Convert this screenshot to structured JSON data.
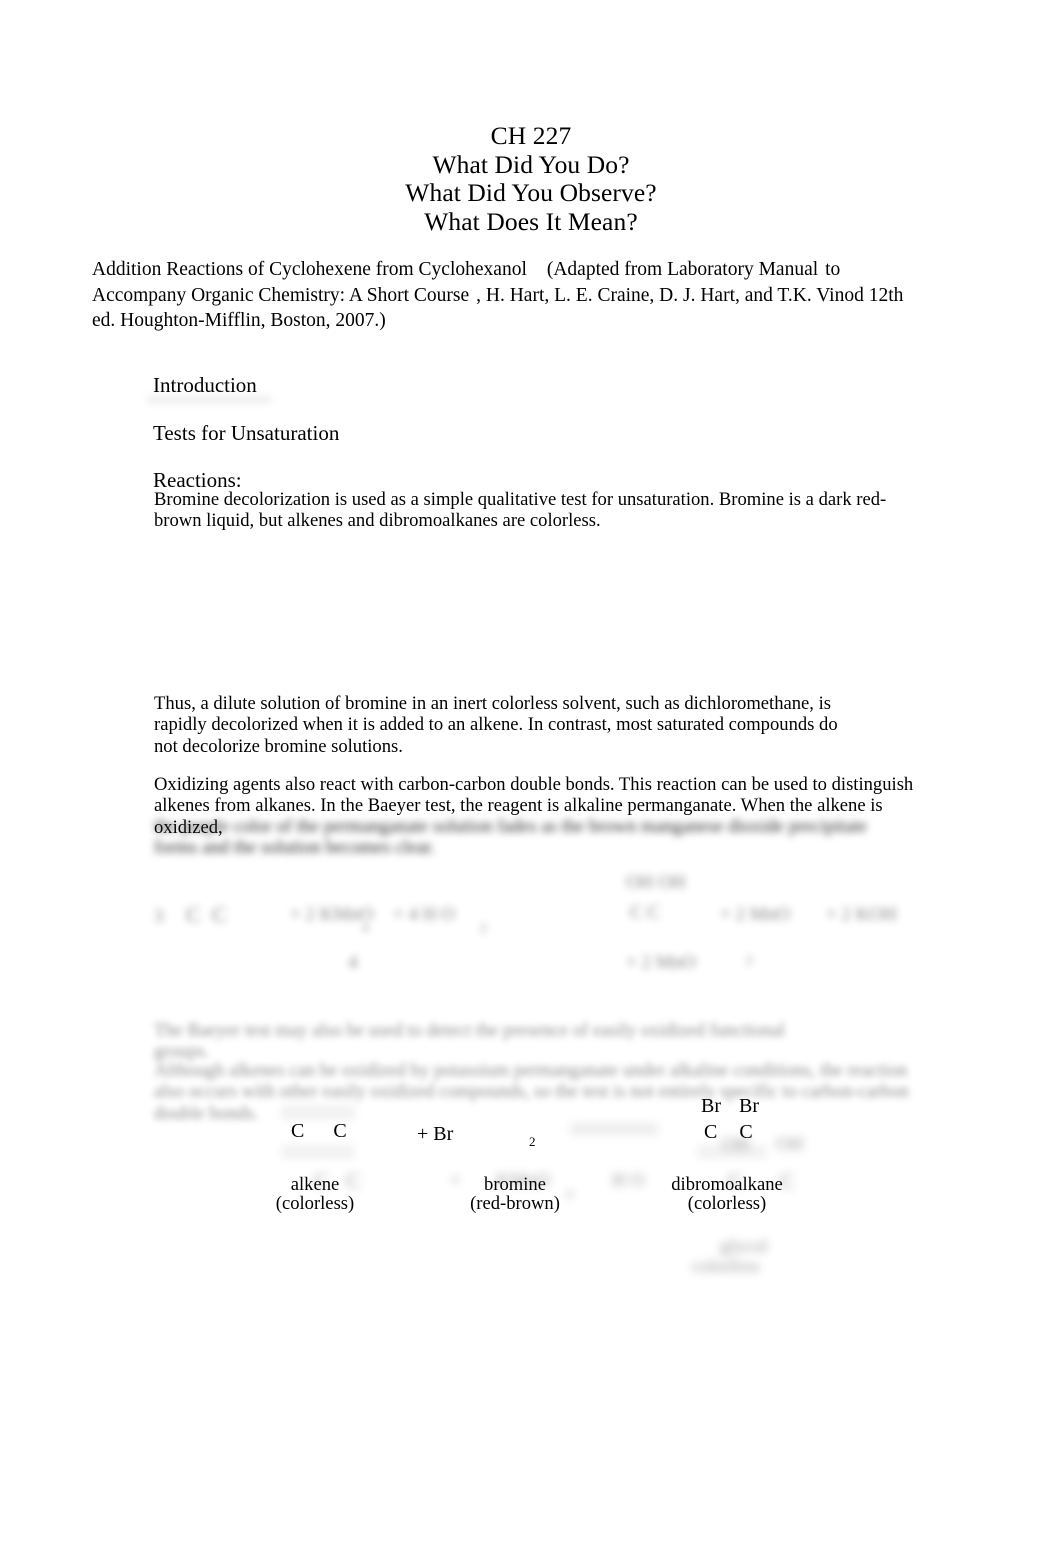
{
  "document": {
    "title_lines": [
      "CH 227",
      "What Did You Do?",
      "What Did You Observe?",
      "What Does It Mean?"
    ],
    "citation": {
      "experiment_title": "Addition Reactions of Cyclohexene from Cyclohexanol",
      "source_open": "(Adapted from Laboratory Manual",
      "source_to": "to",
      "source_line2_a": "Accompany Organic Chemistry: A Short Course",
      "source_line2_b": ", H. Hart, L. E. Craine, D. J. Hart, and T.K. Vinod 12th ed.",
      "source_line3": "Houghton-Mifflin, Boston, 2007.)"
    },
    "headings": {
      "introduction": "Introduction",
      "tests_for_unsaturation": "Tests for Unsaturation",
      "reactions": "Reactions:"
    },
    "paragraphs": {
      "bromine_decolorization": "Bromine decolorization is used as a simple qualitative test for unsaturation. Bromine is a dark red-brown liquid, but alkenes and dibromoalkanes are colorless.",
      "thus_dilute": "Thus, a dilute solution of bromine in an inert colorless solvent, such as dichloromethane, is rapidly decolorized when it is added to an alkene. In contrast, most saturated compounds do not decolorize bromine solutions.",
      "oxidizing_agents": "Oxidizing agents also react with carbon-carbon double bonds. This reaction can be used to distinguish alkenes from alkanes. In the Baeyer test, the reagent is alkaline permanganate. When the alkene is oxidized,",
      "oxidizing_agents_blurred": "the purple color of the permanganate solution fades as the brown manganese dioxide precipitate forms and the solution becomes clear.",
      "blurred_line_2": "The Baeyer test may also be used to detect the presence of easily oxidized functional groups.",
      "blurred_paragraph_3": "Although alkenes can be oxidized by potassium permanganate under alkaline conditions, the reaction also occurs with other easily oxidized compounds, so the test is not entirely specific to carbon-carbon double bonds."
    },
    "scheme1": {
      "reactant_alkene_atoms": "C  C",
      "reagent_plus": "+ Br",
      "reagent_subscript": "2",
      "product_br_left": "Br",
      "product_br_right": "Br",
      "product_c_left": "C",
      "product_c_right": "C",
      "label_alkene": "alkene",
      "label_alkene_color": "(colorless)",
      "label_bromine": "bromine",
      "label_bromine_color": "(red-brown)",
      "label_dibromo": "dibromoalkane",
      "label_dibromo_color": "(colorless)"
    },
    "scheme2_blurred": {
      "note": "blurred permanganate oxidation reaction scheme",
      "fragments": [
        "3",
        "C",
        "C",
        "+ 2 KMnO",
        "4",
        "+ 4 H O",
        "2",
        "OH  OH",
        "C   C",
        "+ 2 MnO",
        "2",
        "+ 2 KOH"
      ]
    },
    "scheme3_blurred": {
      "note": "blurred second reaction scheme",
      "fragments": [
        "C",
        "C",
        "+",
        "KMnO",
        "4",
        "H O",
        "OH",
        "OH",
        "C",
        "C",
        "glycol",
        "colorless"
      ]
    }
  }
}
